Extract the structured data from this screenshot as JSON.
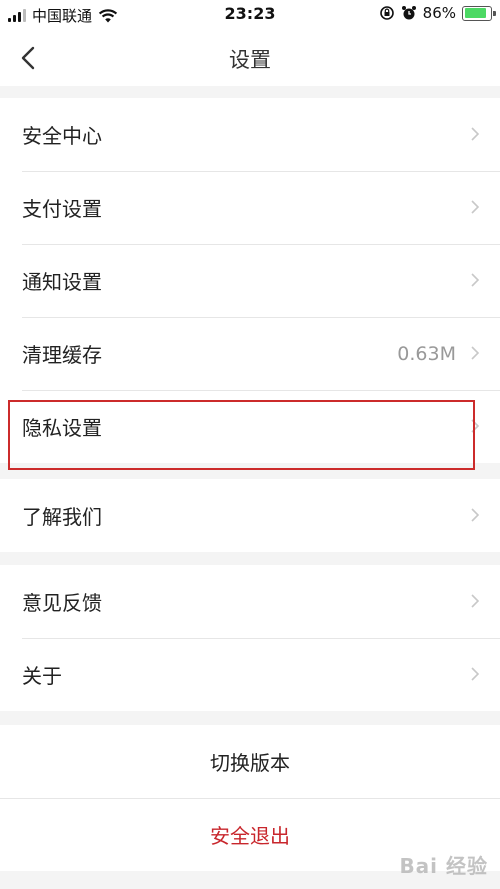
{
  "status_bar": {
    "carrier": "中国联通",
    "time": "23:23",
    "battery_percent": "86%",
    "battery_level": 0.86
  },
  "nav": {
    "title": "设置"
  },
  "groups": [
    {
      "items": [
        {
          "label": "安全中心",
          "value": ""
        },
        {
          "label": "支付设置",
          "value": ""
        },
        {
          "label": "通知设置",
          "value": ""
        },
        {
          "label": "清理缓存",
          "value": "0.63M"
        },
        {
          "label": "隐私设置",
          "value": ""
        }
      ]
    },
    {
      "items": [
        {
          "label": "了解我们",
          "value": ""
        }
      ]
    },
    {
      "items": [
        {
          "label": "意见反馈",
          "value": ""
        },
        {
          "label": "关于",
          "value": ""
        }
      ]
    }
  ],
  "actions": {
    "switch_version": "切换版本",
    "logout": "安全退出"
  },
  "colors": {
    "highlight": "#cc2b2b",
    "logout_text": "#c8262c",
    "battery_fill": "#4cd964"
  },
  "watermark": "Bai 经验"
}
